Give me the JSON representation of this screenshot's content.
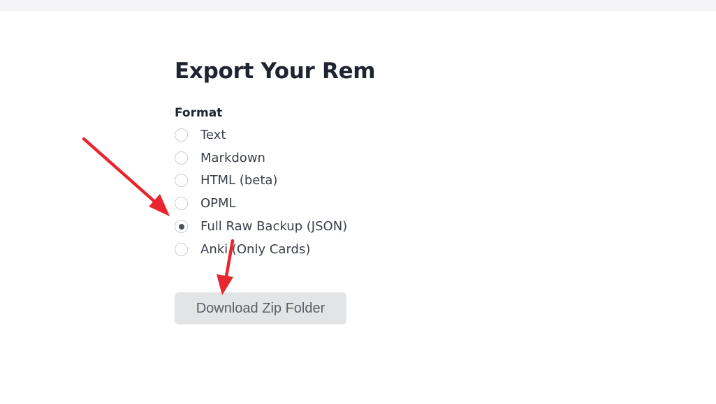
{
  "export": {
    "title": "Export Your Rem",
    "format_label": "Format",
    "options": [
      {
        "label": "Text",
        "selected": false
      },
      {
        "label": "Markdown",
        "selected": false
      },
      {
        "label": "HTML (beta)",
        "selected": false
      },
      {
        "label": "OPML",
        "selected": false
      },
      {
        "label": "Full Raw Backup (JSON)",
        "selected": true
      },
      {
        "label": "Anki (Only Cards)",
        "selected": false
      }
    ],
    "download_label": "Download Zip Folder"
  },
  "colors": {
    "annotation_arrow": "#e8262f",
    "button_bg": "#e3e4e6",
    "radio_dot": "#4a505d"
  }
}
